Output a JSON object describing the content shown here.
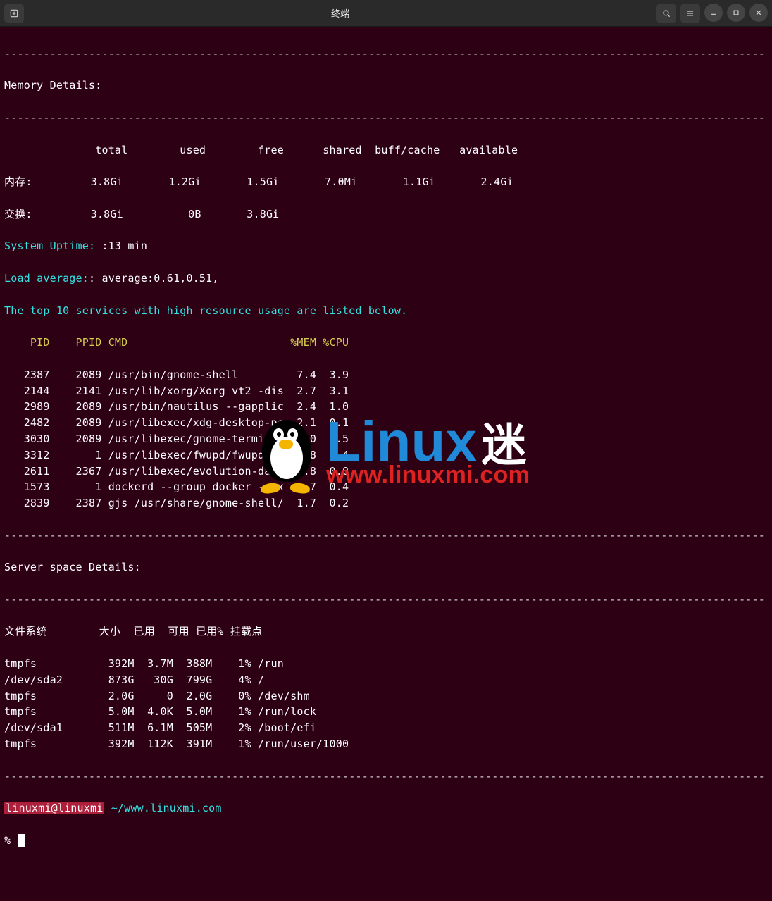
{
  "title": "终端",
  "dashes": "---------------------------------------------------------------------------------------------------------------------",
  "memory_header": "Memory Details:",
  "mem_columns": "              total        used        free      shared  buff/cache   available",
  "mem_row": "内存:         3.8Gi       1.2Gi       1.5Gi       7.0Mi       1.1Gi       2.4Gi",
  "swap_row": "交换:         3.8Gi          0B       3.8Gi",
  "uptime_label": "System Uptime: ",
  "uptime_value": ":13 min",
  "loadavg_label": "Load average:",
  "loadavg_value": ": average:0.61,0.51,",
  "top10": "The top 10 services with high resource usage are listed below.",
  "proc_header": "    PID    PPID CMD                         %MEM %CPU",
  "procs": [
    "   2387    2089 /usr/bin/gnome-shell         7.4  3.9",
    "   2144    2141 /usr/lib/xorg/Xorg vt2 -dis  2.7  3.1",
    "   2989    2089 /usr/bin/nautilus --gapplic  2.4  1.0",
    "   2482    2089 /usr/libexec/xdg-desktop-po  2.1  0.1",
    "   3030    2089 /usr/libexec/gnome-terminal  2.0  1.5",
    "   3312       1 /usr/libexec/fwupd/fwupd     1.8  1.4",
    "   2611    2367 /usr/libexec/evolution-data  1.8  0.0",
    "   1573       1 dockerd --group docker --ex  1.7  0.4",
    "   2839    2387 gjs /usr/share/gnome-shell/  1.7  0.2"
  ],
  "space_header": "Server space Details:",
  "df_columns": "文件系统        大小  已用  可用 已用% 挂载点",
  "df_rows": [
    "tmpfs           392M  3.7M  388M    1% /run",
    "/dev/sda2       873G   30G  799G    4% /",
    "tmpfs           2.0G     0  2.0G    0% /dev/shm",
    "tmpfs           5.0M  4.0K  5.0M    1% /run/lock",
    "/dev/sda1       511M  6.1M  505M    2% /boot/efi",
    "tmpfs           392M  112K  391M    1% /run/user/1000"
  ],
  "prompt_user": "linuxmi@linuxmi",
  "prompt_path": " ~/www.linuxmi.com",
  "prompt2": "% ",
  "watermark": {
    "brand": "Linux",
    "suffix": "迷",
    "url": "www.linuxmi.com"
  }
}
